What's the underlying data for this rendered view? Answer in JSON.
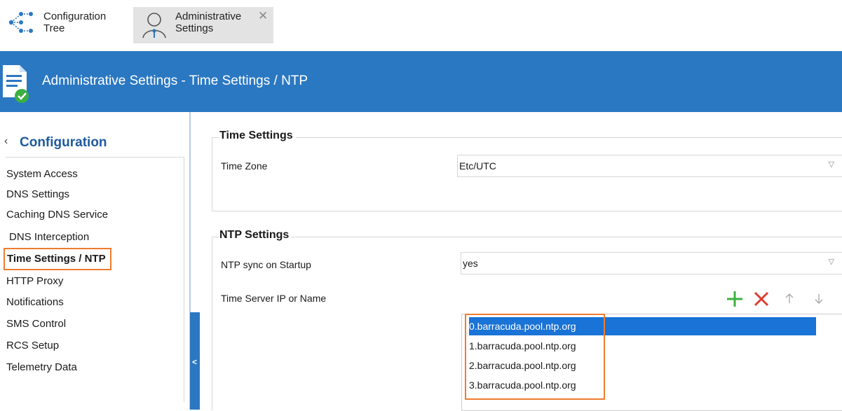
{
  "tabs": [
    {
      "label_line1": "Configuration",
      "label_line2": "Tree",
      "icon": "tree-icon"
    },
    {
      "label_line1": "Administrative",
      "label_line2": "Settings",
      "icon": "user-icon",
      "close": "✕"
    }
  ],
  "header": {
    "title": "Administrative Settings - Time Settings / NTP",
    "icon": "document-check-icon"
  },
  "sidebar": {
    "heading": "Configuration",
    "caret": "‹",
    "items": [
      {
        "label": "System Access"
      },
      {
        "label": "DNS Settings"
      },
      {
        "label": "Caching DNS Service"
      },
      {
        "label": "DNS Interception"
      },
      {
        "label": "Time Settings / NTP",
        "active": true
      },
      {
        "label": "HTTP Proxy"
      },
      {
        "label": "Notifications"
      },
      {
        "label": "SMS Control"
      },
      {
        "label": "RCS Setup"
      },
      {
        "label": "Telemetry Data"
      }
    ],
    "collapse_glyph": "<"
  },
  "time_settings": {
    "group_title": "Time Settings",
    "time_zone_label": "Time Zone",
    "time_zone_value": "Etc/UTC"
  },
  "ntp_settings": {
    "group_title": "NTP Settings",
    "sync_label": "NTP sync on Startup",
    "sync_value": "yes",
    "servers_label": "Time Server IP or Name",
    "servers": [
      "0.barracuda.pool.ntp.org",
      "1.barracuda.pool.ntp.org",
      "2.barracuda.pool.ntp.org",
      "3.barracuda.pool.ntp.org"
    ],
    "selected_index": 0
  },
  "colors": {
    "accent_blue": "#2b78c2",
    "highlight_orange": "#ef7c2e",
    "selection_blue": "#1a73d6",
    "add_green": "#3cb043",
    "remove_red": "#e03c31"
  }
}
